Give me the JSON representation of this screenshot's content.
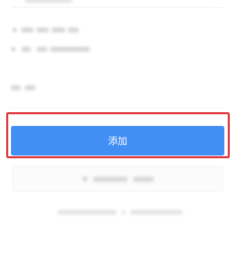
{
  "add_button": {
    "label": "添加",
    "color": "#418ef5"
  },
  "highlight": {
    "color": "#e0393e"
  }
}
